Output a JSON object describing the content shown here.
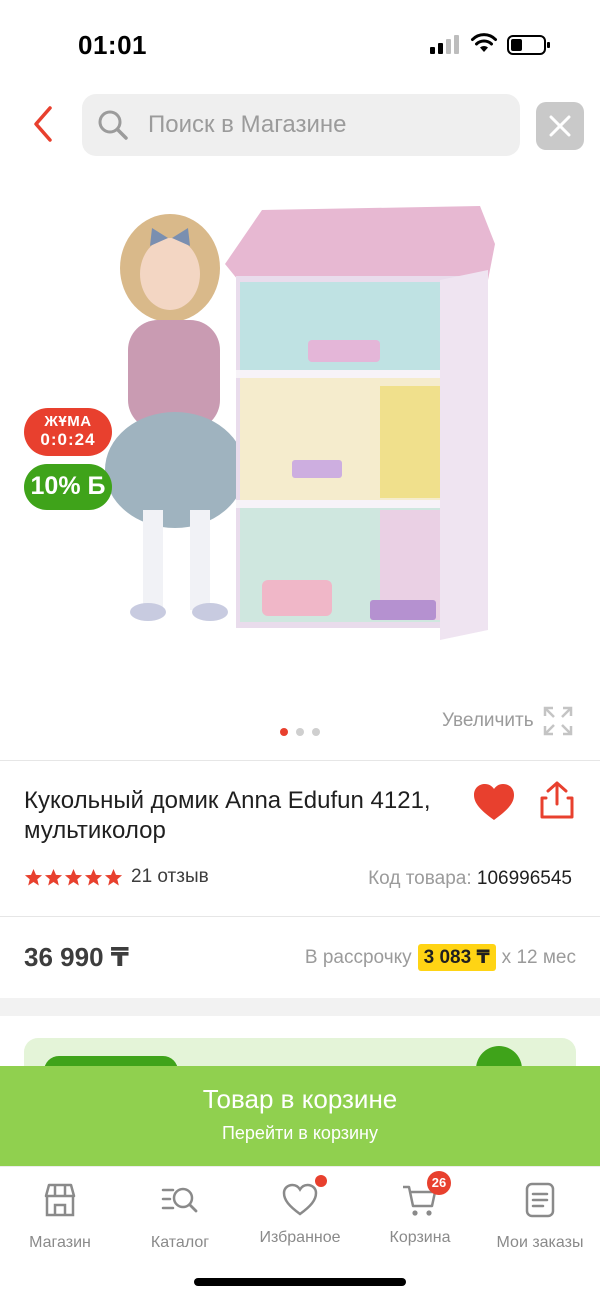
{
  "status_bar": {
    "time": "01:01"
  },
  "header": {
    "search_placeholder": "Поиск в Магазине"
  },
  "product": {
    "badges": {
      "promo_line1": "ЖҰМА",
      "promo_line2": "0:0:24",
      "bonus": "10% Б"
    },
    "zoom_label": "Увеличить",
    "gallery": {
      "total": 3,
      "active": 1
    },
    "title": "Кукольный домик Anna Edufun 4121, мультиколор",
    "rating": 5,
    "reviews": "21 отзыв",
    "sku_label": "Код товара:",
    "sku_value": "106996545",
    "price": "36 990 ₸",
    "installment_prefix": "В рассрочку",
    "installment_amount": "3 083 ₸",
    "installment_suffix": "x 12 мес"
  },
  "cart_banner": {
    "title": "Товар в корзине",
    "subtitle": "Перейти в корзину"
  },
  "bottom_nav": {
    "items": [
      {
        "label": "Магазин",
        "icon": "shop-icon"
      },
      {
        "label": "Каталог",
        "icon": "catalog-search-icon"
      },
      {
        "label": "Избранное",
        "icon": "heart-icon"
      },
      {
        "label": "Корзина",
        "icon": "cart-icon",
        "badge": "26"
      },
      {
        "label": "Мои заказы",
        "icon": "orders-icon"
      }
    ]
  },
  "colors": {
    "accent": "#e8402e",
    "green_banner": "#90d04f",
    "bonus_green": "#3fa31a",
    "installment_yellow": "#ffd414"
  }
}
